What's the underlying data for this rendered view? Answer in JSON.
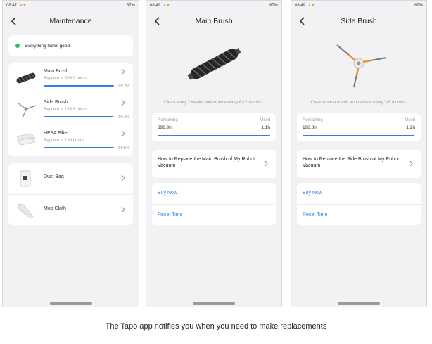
{
  "screens": [
    {
      "status_time": "08:47",
      "status_right": "87%",
      "title": "Maintenance",
      "status_message": "Everything looks good.",
      "parts": [
        {
          "name": "Main Brush",
          "detail": "Replace in 398.9 hours.",
          "percent_label": "99.7%",
          "level": 0.997,
          "icon": "main-brush-thumb"
        },
        {
          "name": "Side Brush",
          "detail": "Replace in 198.8 hours.",
          "percent_label": "99.4%",
          "level": 0.994,
          "icon": "side-brush-thumb"
        },
        {
          "name": "HEPA Filter",
          "detail": "Replace in 199 hours.",
          "percent_label": "99.5%",
          "level": 0.995,
          "icon": "hepa-filter-thumb"
        }
      ],
      "others": [
        {
          "name": "Dust Bag",
          "icon": "dust-bag-thumb"
        },
        {
          "name": "Mop Cloth",
          "icon": "mop-cloth-thumb"
        }
      ]
    },
    {
      "status_time": "08:49",
      "status_right": "87%",
      "title": "Main Brush",
      "hint": "Clean every 2 weeks and replace every 6-12 months.",
      "remaining_label": "Remaining",
      "remaining_value": "398.9h",
      "used_label": "Used",
      "used_value": "1.1h",
      "level": 0.997,
      "howto": "How to Replace the Main Brush of My Robot Vacuum",
      "buy": "Buy Now",
      "reset": "Reset Time"
    },
    {
      "status_time": "08:49",
      "status_right": "87%",
      "title": "Side Brush",
      "hint": "Clean once a month and replace every 3-6 months.",
      "remaining_label": "Remaining",
      "remaining_value": "198.8h",
      "used_label": "Used",
      "used_value": "1.2h",
      "level": 0.994,
      "howto": "How to Replace the Side Brush of My Robot Vacuum",
      "buy": "Buy Now",
      "reset": "Reset Time"
    }
  ],
  "caption": "The Tapo app notifies you when you need to make replacements",
  "colors": {
    "accent": "#2f80ed",
    "ok": "#22c55e",
    "background": "#f2f2f4"
  }
}
